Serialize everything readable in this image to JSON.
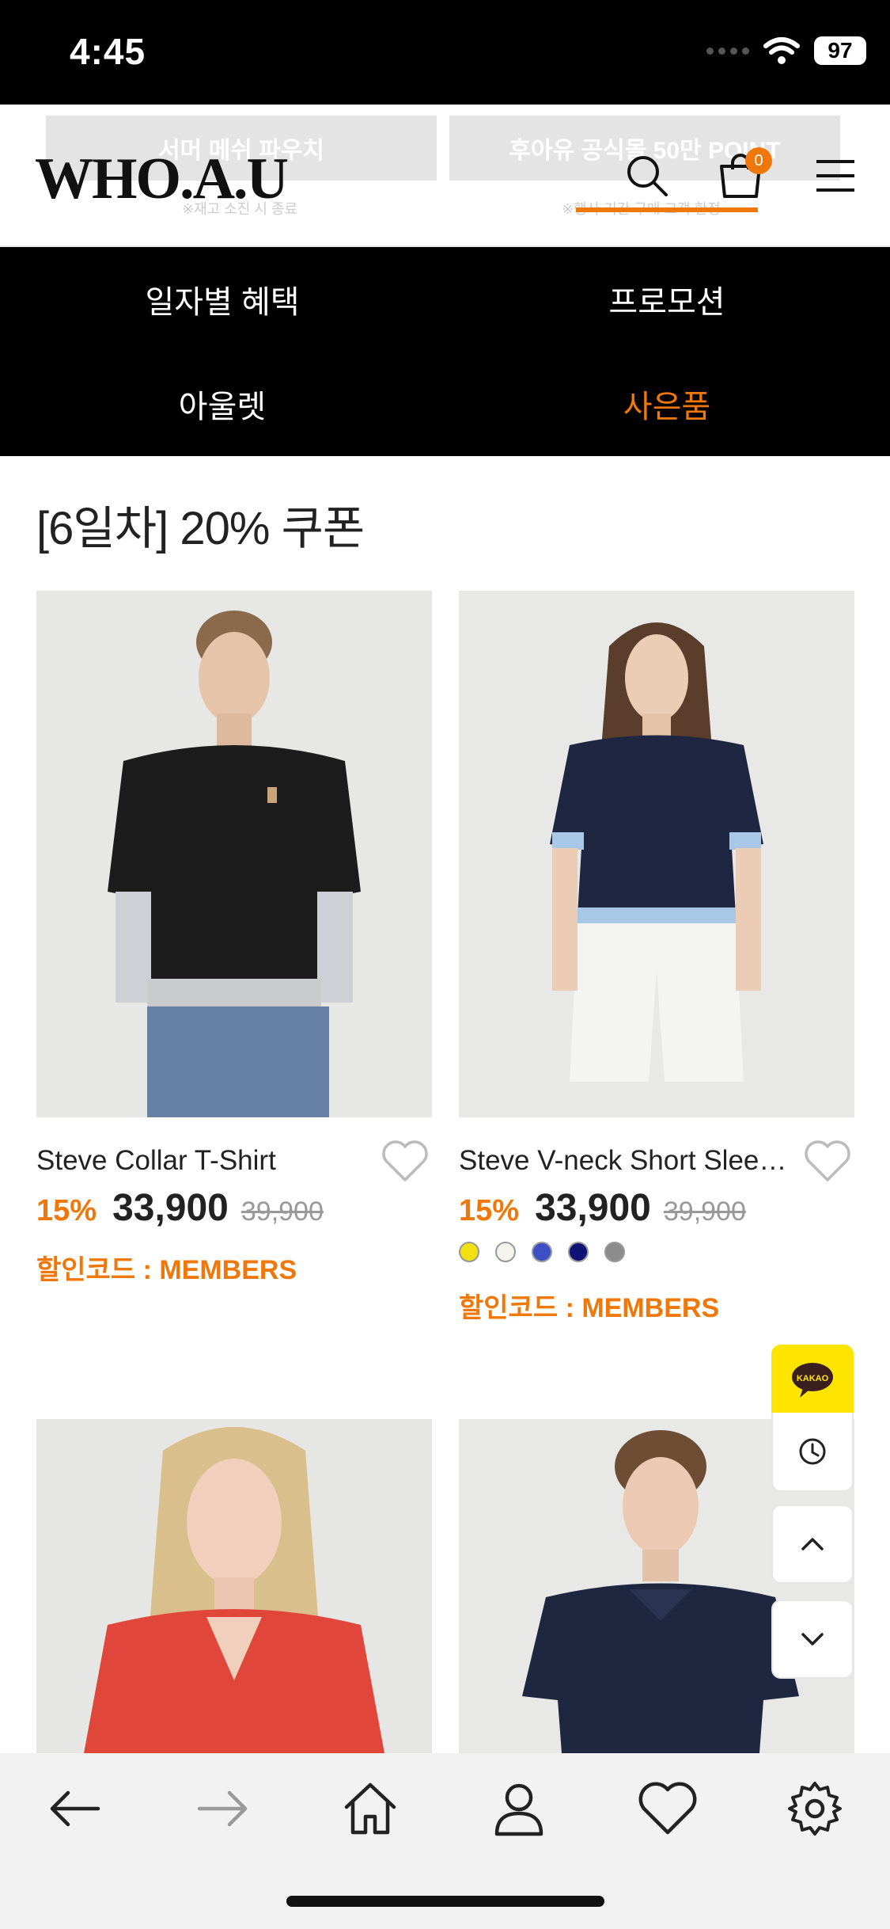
{
  "status_bar": {
    "time": "4:45",
    "battery": "97"
  },
  "header": {
    "logo": "WHO.A.U",
    "cart_count": "0",
    "ghost_banner_left": "서머 메쉬 파우치",
    "ghost_banner_right": "후아유 공식몰 50만 POINT",
    "ghost_note_left": "※재고 소진 시 종료",
    "ghost_note_right": "※행사 기간 구매 고객 한정"
  },
  "tabs": [
    {
      "label": "일자별 혜택",
      "active": false
    },
    {
      "label": "프로모션",
      "active": false
    },
    {
      "label": "아울렛",
      "active": false
    },
    {
      "label": "사은품",
      "active": true
    }
  ],
  "section": {
    "title": "[6일차] 20% 쿠폰"
  },
  "products": [
    {
      "name": "Steve Collar T-Shirt",
      "discount": "15%",
      "price": "33,900",
      "original_price": "39,900",
      "code": "할인코드 : MEMBERS",
      "swatches": []
    },
    {
      "name": "Steve V-neck Short Slee…",
      "discount": "15%",
      "price": "33,900",
      "original_price": "39,900",
      "code": "할인코드 : MEMBERS",
      "swatches": [
        "#f2e011",
        "#f4f4ec",
        "#3d4fc7",
        "#101276",
        "#8c8c8c"
      ]
    },
    {
      "name": "",
      "discount": "",
      "price": "",
      "original_price": "",
      "code": ""
    },
    {
      "name": "",
      "discount": "",
      "price": "",
      "original_price": "",
      "code": ""
    }
  ],
  "floating": {
    "kakao_label": "KAKAO"
  },
  "colors": {
    "accent": "#f0780a",
    "tabs_bg": "#000000",
    "kakao": "#fde500"
  }
}
